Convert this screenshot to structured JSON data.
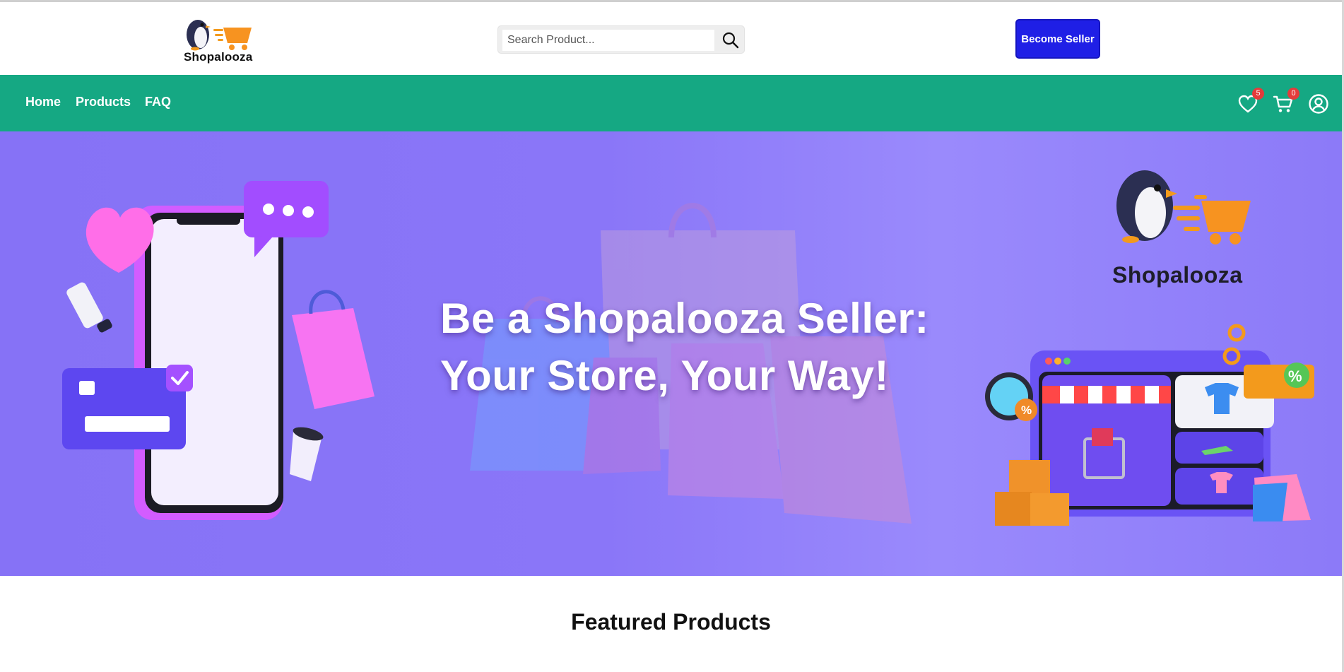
{
  "header": {
    "logo_text": "Shopalooza",
    "search": {
      "placeholder": "Search Product...",
      "value": ""
    },
    "become_seller_label": "Become Seller"
  },
  "nav": {
    "links": [
      "Home",
      "Products",
      "FAQ"
    ],
    "wishlist_count": "5",
    "cart_count": "0"
  },
  "hero": {
    "title_line1": "Be a Shopalooza Seller:",
    "title_line2": "Your Store, Your Way!",
    "logo_text": "Shopalooza"
  },
  "featured": {
    "heading": "Featured Products"
  },
  "colors": {
    "nav_bg": "#15a883",
    "seller_button": "#1f1fe6",
    "hero_bg": "#8a76f8",
    "badge": "#e43b3b"
  }
}
